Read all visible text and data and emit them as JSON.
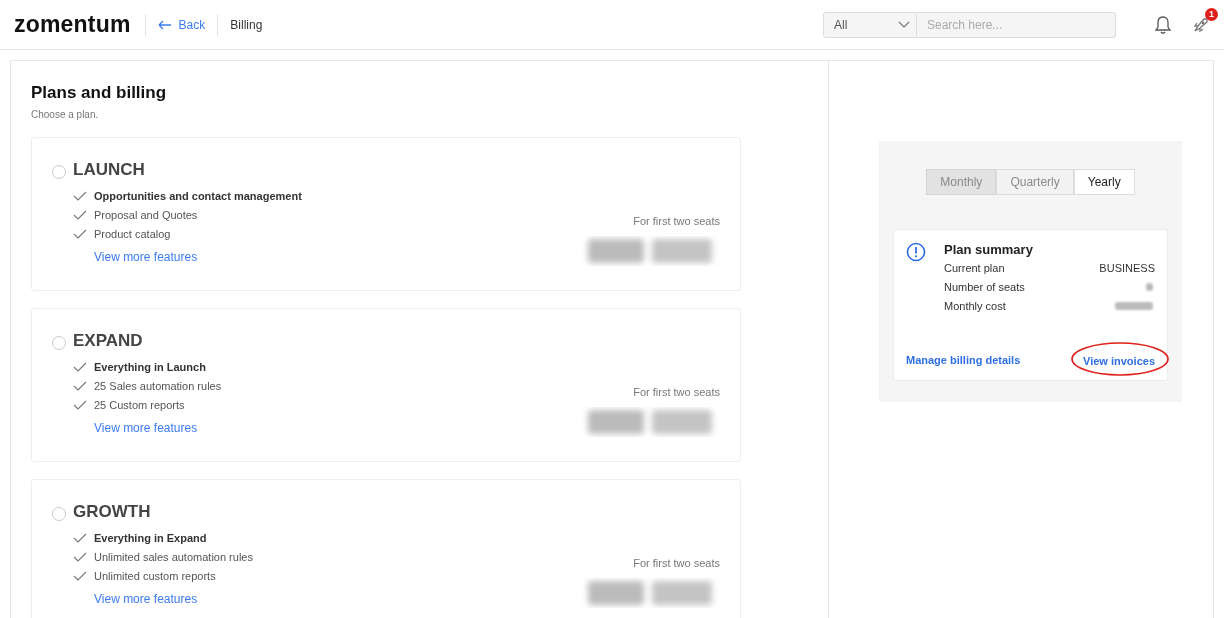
{
  "header": {
    "logo": "zomentum",
    "back": "Back",
    "breadcrumb": "Billing",
    "search_scope": "All",
    "search": {
      "placeholder": "Search here..."
    },
    "notification_badge": "1"
  },
  "page": {
    "title": "Plans and billing",
    "subtitle": "Choose a plan."
  },
  "plans": [
    {
      "name": "LAUNCH",
      "selected": false,
      "features": [
        {
          "text": "Opportunities and contact management",
          "bold": true
        },
        {
          "text": "Proposal and Quotes",
          "bold": false
        },
        {
          "text": "Product catalog",
          "bold": false
        }
      ],
      "link": "View more features",
      "price_note": "For first two seats",
      "price_hidden": true
    },
    {
      "name": "EXPAND",
      "selected": false,
      "features": [
        {
          "text": "Everything in Launch",
          "bold": true
        },
        {
          "text": "25 Sales automation rules",
          "bold": false
        },
        {
          "text": "25 Custom reports",
          "bold": false
        }
      ],
      "link": "View more features",
      "price_note": "For first two seats",
      "price_hidden": true
    },
    {
      "name": "GROWTH",
      "selected": false,
      "features": [
        {
          "text": "Everything in Expand",
          "bold": true
        },
        {
          "text": "Unlimited sales automation rules",
          "bold": false
        },
        {
          "text": "Unlimited custom reports",
          "bold": false
        }
      ],
      "link": "View more features",
      "price_note": "For first two seats",
      "price_hidden": true
    }
  ],
  "billing_periods": [
    {
      "label": "Monthly",
      "selected": true,
      "disabled": true
    },
    {
      "label": "Quarterly",
      "selected": false,
      "disabled": true
    },
    {
      "label": "Yearly",
      "selected": false,
      "disabled": false
    }
  ],
  "summary": {
    "title": "Plan summary",
    "rows": [
      {
        "label": "Current plan",
        "value": "BUSINESS",
        "value_hidden": false
      },
      {
        "label": "Number of seats",
        "value_hidden": true
      },
      {
        "label": "Monthly cost",
        "value_hidden": true
      }
    ],
    "manage_link": "Manage billing details",
    "invoices_link": "View invoices",
    "invoices_highlighted": true
  }
}
